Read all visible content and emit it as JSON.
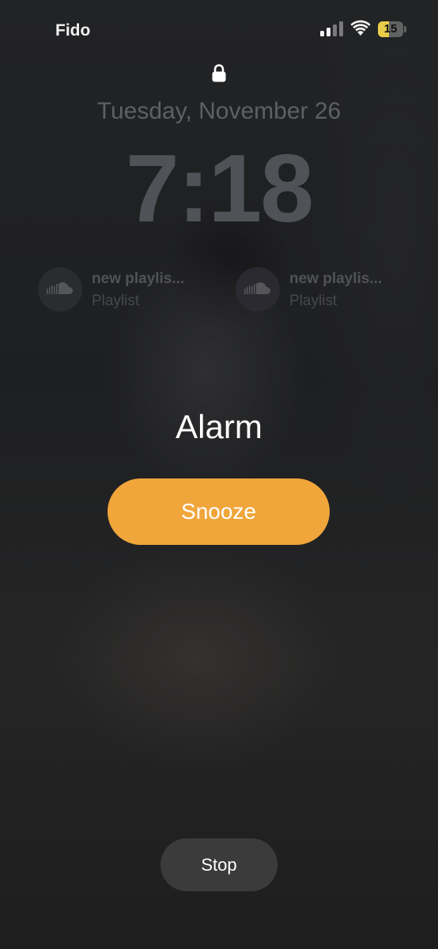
{
  "status_bar": {
    "carrier": "Fido",
    "battery_level": "15",
    "battery_fraction": 0.15
  },
  "lock_screen": {
    "date": "Tuesday, November 26",
    "time": "7:18"
  },
  "widgets": [
    {
      "icon": "soundcloud-icon",
      "title": "new playlis...",
      "subtitle": "Playlist"
    },
    {
      "icon": "soundcloud-icon",
      "title": "new playlis...",
      "subtitle": "Playlist"
    }
  ],
  "alarm": {
    "title": "Alarm",
    "snooze_label": "Snooze",
    "stop_label": "Stop"
  },
  "colors": {
    "snooze_accent": "#f0a63b",
    "battery_low": "#e8cc4a"
  }
}
